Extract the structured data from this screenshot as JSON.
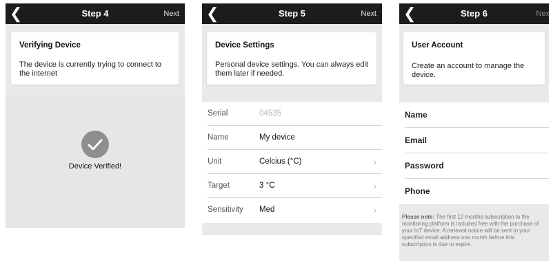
{
  "step4": {
    "nav": {
      "back_icon": "chevron-left-icon",
      "title": "Step 4",
      "next_label": "Next"
    },
    "card": {
      "title": "Verifying Device",
      "body": "The device is currently trying to connect to the internet"
    },
    "status": {
      "icon": "checkmark-icon",
      "text": "Device Verified!"
    }
  },
  "step5": {
    "nav": {
      "back_icon": "chevron-left-icon",
      "title": "Step 5",
      "next_label": "Next"
    },
    "card": {
      "title": "Device Settings",
      "body": "Personal device settings. You can always edit them later if needed."
    },
    "rows": [
      {
        "label": "Serial",
        "value": "04535"
      },
      {
        "label": "Name",
        "value": "My device"
      },
      {
        "label": "Unit",
        "value": "Celcius (°C)"
      },
      {
        "label": "Target",
        "value": "3 °C"
      },
      {
        "label": "Sensitivity",
        "value": "Med"
      }
    ]
  },
  "step6": {
    "nav": {
      "back_icon": "chevron-left-icon",
      "title": "Step 6",
      "next_label": "Next",
      "next_disabled": true
    },
    "card": {
      "title": "User Account",
      "body": "Create an account to manage the device."
    },
    "fields": [
      {
        "label": "Name"
      },
      {
        "label": "Email"
      },
      {
        "label": "Password"
      },
      {
        "label": "Phone"
      }
    ],
    "note": {
      "bold": "Please note:",
      "text": " The first 12 months subscription to the monitoring platform is included free with the purchase of your IoT device. A renewal notice will be sent to your specified email address one month before this subscription is due to expire."
    }
  },
  "colors": {
    "navbar": "#1c1c1c",
    "background": "#e9e9e9",
    "check": "#8e8e8e"
  }
}
